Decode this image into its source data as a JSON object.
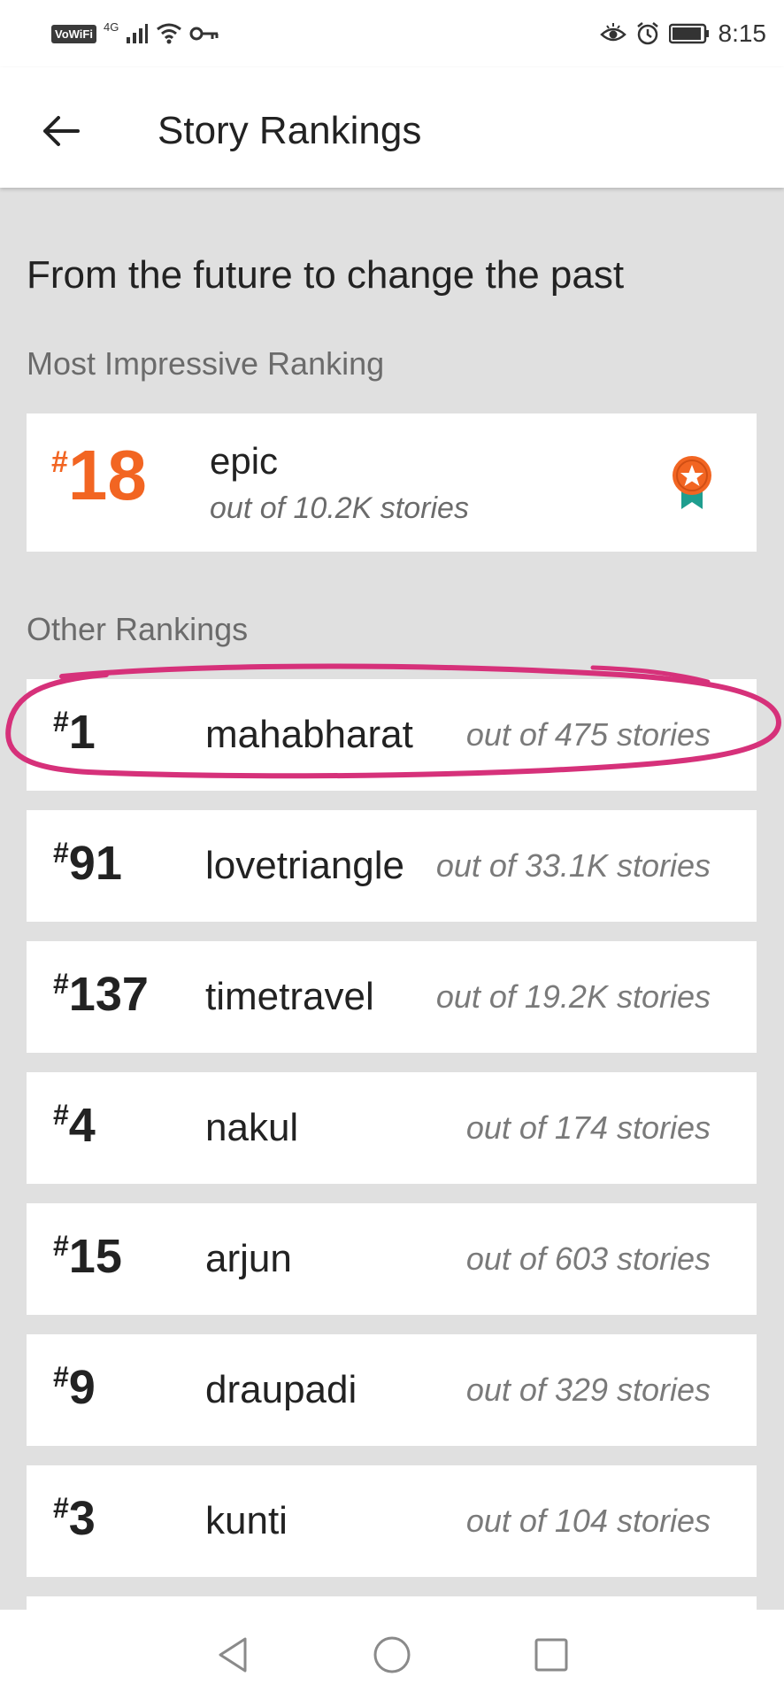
{
  "status_bar": {
    "network_badge": "VoWiFi",
    "network_type": "4G",
    "time": "8:15",
    "icons": [
      "signal-icon",
      "wifi-icon",
      "vpn-key-icon",
      "eye-comfort-icon",
      "alarm-icon",
      "battery-icon"
    ]
  },
  "header": {
    "title": "Story Rankings"
  },
  "story": {
    "title": "From the future to change the past"
  },
  "most_impressive": {
    "label": "Most Impressive Ranking",
    "hash": "#",
    "rank": "18",
    "tag": "epic",
    "subtitle": "out of 10.2K stories",
    "accent": "#f26522",
    "icon": "ribbon-badge-icon"
  },
  "other": {
    "label": "Other Rankings",
    "items": [
      {
        "hash": "#",
        "rank": "1",
        "tag": "mahabharat",
        "count": "out of 475 stories"
      },
      {
        "hash": "#",
        "rank": "91",
        "tag": "lovetriangle",
        "count": "out of 33.1K stories"
      },
      {
        "hash": "#",
        "rank": "137",
        "tag": "timetravel",
        "count": "out of 19.2K stories"
      },
      {
        "hash": "#",
        "rank": "4",
        "tag": "nakul",
        "count": "out of 174 stories"
      },
      {
        "hash": "#",
        "rank": "15",
        "tag": "arjun",
        "count": "out of 603 stories"
      },
      {
        "hash": "#",
        "rank": "9",
        "tag": "draupadi",
        "count": "out of 329 stories"
      },
      {
        "hash": "#",
        "rank": "3",
        "tag": "kunti",
        "count": "out of 104 stories"
      }
    ]
  },
  "annotation_color": "#d6317a",
  "nav": {
    "buttons": [
      "back-triangle-icon",
      "home-circle-icon",
      "recents-square-icon"
    ]
  }
}
